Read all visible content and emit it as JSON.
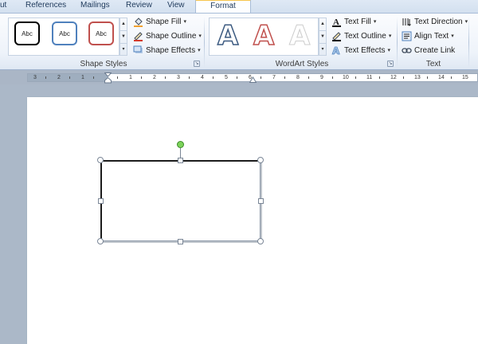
{
  "tabs": [
    {
      "label": "ut",
      "active": false
    },
    {
      "label": "References",
      "active": false
    },
    {
      "label": "Mailings",
      "active": false
    },
    {
      "label": "Review",
      "active": false
    },
    {
      "label": "View",
      "active": false
    },
    {
      "label": "Format",
      "active": true
    }
  ],
  "shape_styles": {
    "group_label": "Shape Styles",
    "presets": [
      "Abc",
      "Abc",
      "Abc"
    ],
    "commands": {
      "fill": "Shape Fill",
      "outline": "Shape Outline",
      "effects": "Shape Effects"
    }
  },
  "wordart_styles": {
    "group_label": "WordArt Styles",
    "letters": [
      "A",
      "A",
      "A"
    ],
    "commands": {
      "fill": "Text Fill",
      "outline": "Text Outline",
      "effects": "Text Effects"
    }
  },
  "text_group": {
    "group_label": "Text",
    "commands": {
      "direction": "Text Direction",
      "align": "Align Text",
      "link": "Create Link"
    }
  },
  "ruler": {
    "labels": [
      "3",
      "2",
      "1",
      "",
      "1",
      "2",
      "3",
      "4",
      "5",
      "6",
      "7",
      "8",
      "9",
      "10",
      "11",
      "12",
      "13",
      "14",
      "15",
      "16"
    ]
  },
  "colors": {
    "accent_tab": "#f7c54d",
    "shape_border": "#1c1c1c",
    "rotation_handle": "#7cd35a",
    "preset_black": "#000000",
    "preset_blue": "#4f81bd",
    "preset_red": "#c0504d"
  },
  "icons": {
    "shape_fill": "paint-bucket-icon",
    "shape_outline": "pen-outline-icon",
    "shape_effects": "shape-effects-icon",
    "text_fill": "text-fill-icon",
    "text_outline": "text-outline-icon",
    "text_effects": "text-effects-icon",
    "text_direction": "text-direction-icon",
    "align_text": "align-text-icon",
    "create_link": "create-link-icon"
  }
}
